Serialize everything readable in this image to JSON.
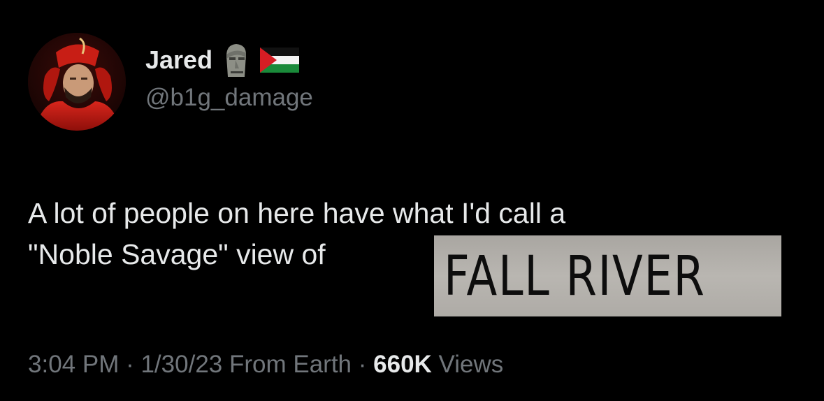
{
  "user": {
    "display_name": "Jared",
    "handle": "@b1g_damage",
    "avatar": "avatar-red-robed-figure",
    "name_emojis": [
      "moai-icon",
      "palestine-flag-icon"
    ]
  },
  "tweet": {
    "line1": "A lot of people on here have what I'd call a",
    "line2": "\"Noble Savage\" view of",
    "sign_text": "FALL RIVER"
  },
  "meta": {
    "time": "3:04 PM",
    "separator1": " · ",
    "date": "1/30/23",
    "source": "From Earth",
    "separator2": " · ",
    "views_count": "660K",
    "views_label": "Views"
  },
  "colors": {
    "background": "#000000",
    "primary_text": "#e7e9ea",
    "secondary_text": "#71767b",
    "sign_background": "#b2afaa"
  }
}
